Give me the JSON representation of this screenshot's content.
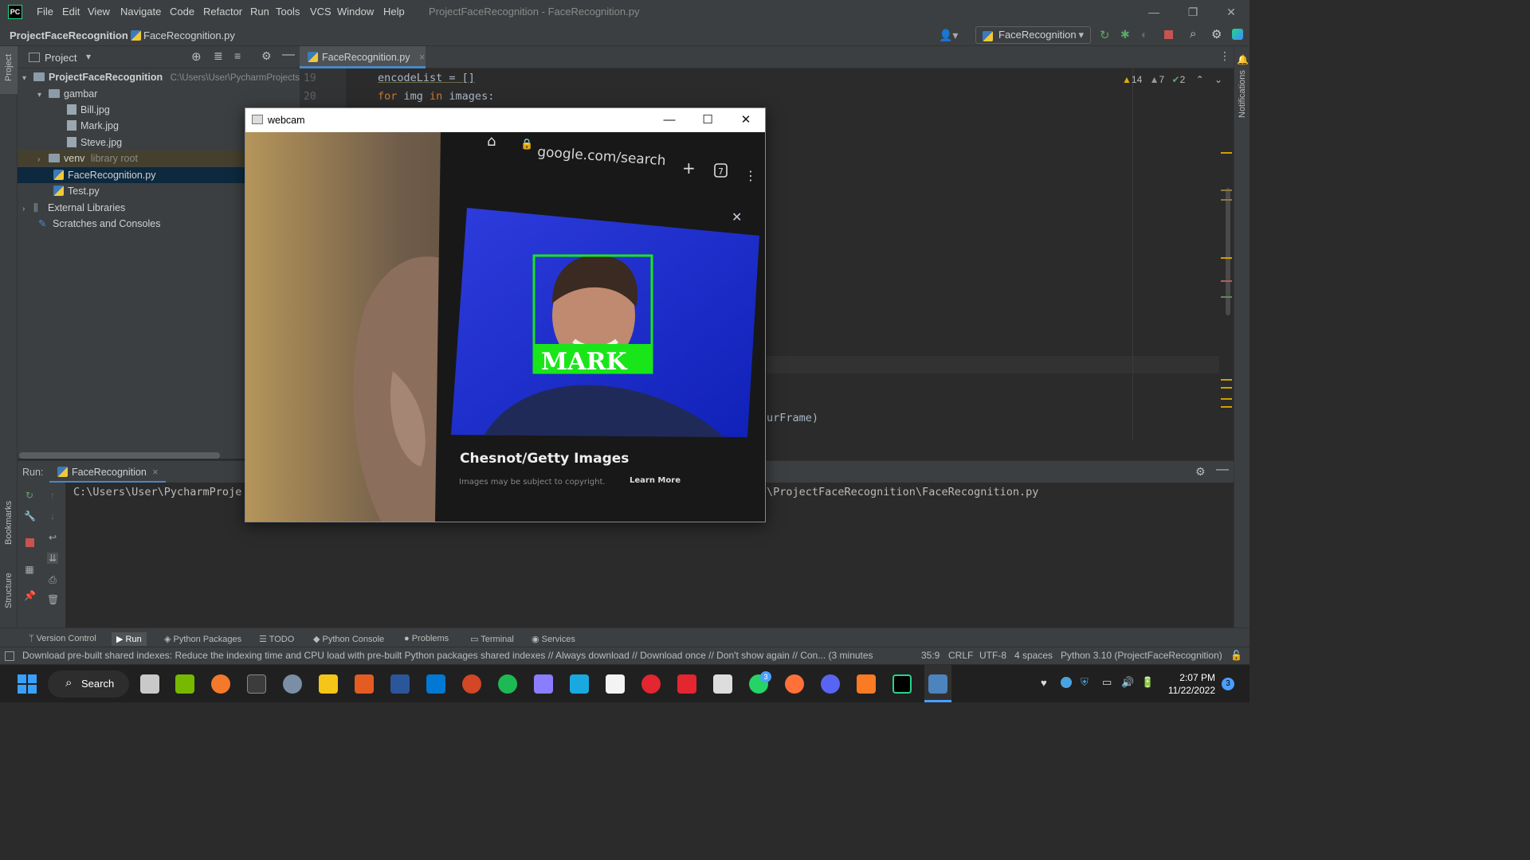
{
  "app": {
    "title": "ProjectFaceRecognition - FaceRecognition.py",
    "menu": [
      "File",
      "Edit",
      "View",
      "Navigate",
      "Code",
      "Refactor",
      "Run",
      "Tools",
      "VCS",
      "Window",
      "Help"
    ]
  },
  "navbar": {
    "project": "ProjectFaceRecognition",
    "file": "FaceRecognition.py",
    "run_config": "FaceRecognition"
  },
  "left_stripe": {
    "project": "Project",
    "bookmarks": "Bookmarks",
    "structure": "Structure"
  },
  "right_stripe": {
    "notifications": "Notifications"
  },
  "project_panel": {
    "header": "Project",
    "tree": [
      {
        "label": "ProjectFaceRecognition",
        "hint": "C:\\Users\\User\\PycharmProjects\\"
      },
      {
        "label": "gambar"
      },
      {
        "label": "Bill.jpg"
      },
      {
        "label": "Mark.jpg"
      },
      {
        "label": "Steve.jpg"
      },
      {
        "label": "venv",
        "hint": "library root"
      },
      {
        "label": "FaceRecognition.py"
      },
      {
        "label": "Test.py"
      },
      {
        "label": "External Libraries"
      },
      {
        "label": "Scratches and Consoles"
      }
    ]
  },
  "editor": {
    "tab": "FaceRecognition.py",
    "lines": [
      {
        "num": "19",
        "code": "encodeList = []"
      },
      {
        "num": "20",
        "kw": "for",
        "mid": " img ",
        "kw2": "in",
        "rest": " images:"
      }
    ],
    "fragment": "urFrame)",
    "inspections": {
      "warnings": "14",
      "weak_warnings": "7",
      "ok": "2"
    }
  },
  "run_panel": {
    "label": "Run:",
    "tab": "FaceRecognition",
    "output_left": "C:\\Users\\User\\PycharmProje",
    "output_right": "\\ProjectFaceRecognition\\FaceRecognition.py"
  },
  "tool_windows": [
    "Version Control",
    "Run",
    "Python Packages",
    "TODO",
    "Python Console",
    "Problems",
    "Terminal",
    "Services"
  ],
  "status_bar": {
    "message": "Download pre-built shared indexes: Reduce the indexing time and CPU load with pre-built Python packages shared indexes // Always download // Download once // Don't show again // Con... (3 minutes",
    "position": "35:9",
    "line_sep": "CRLF",
    "encoding": "UTF-8",
    "indent": "4 spaces",
    "interpreter": "Python 3.10 (ProjectFaceRecognition)"
  },
  "webcam": {
    "title": "webcam",
    "url": "google.com/search",
    "tabs_count": "7",
    "face_label": "MARK",
    "caption": "Chesnot/Getty Images",
    "subcaption": "Images may be subject to copyright.",
    "learn_more": "Learn More",
    "box_color": "#19e619"
  },
  "taskbar": {
    "search": "Search",
    "time": "2:07 PM",
    "date": "11/22/2022",
    "whatsapp_badge": "3",
    "notification_count": "3"
  }
}
